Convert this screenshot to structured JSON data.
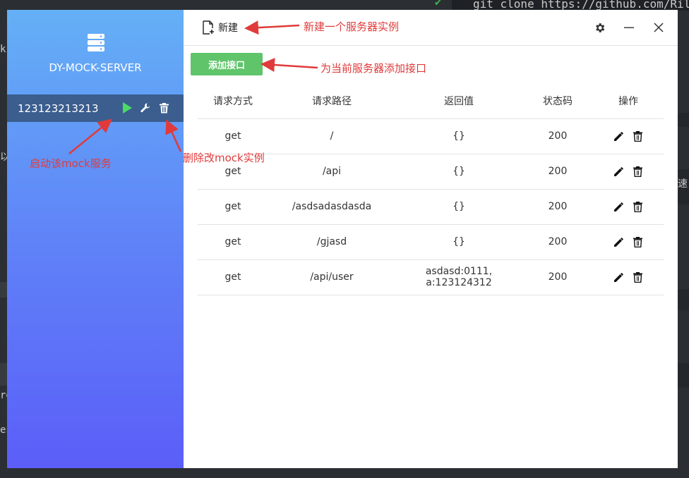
{
  "background": {
    "git_command": "git clone https://github.com/Rily",
    "left_fragments": [
      "k",
      "以",
      "ro",
      "es"
    ],
    "right_fragment": "速"
  },
  "sidebar": {
    "app_title": "DY-MOCK-SERVER",
    "server_icon": "server-icon",
    "instances": [
      {
        "name": "123123213213",
        "actions": [
          "play-icon",
          "wrench-icon",
          "trash-icon"
        ]
      }
    ]
  },
  "toolbar": {
    "new_label": "新建",
    "new_icon": "new-file-icon",
    "window_controls": [
      "gear-icon",
      "minimize-icon",
      "close-icon"
    ]
  },
  "main": {
    "add_api_label": "添加接口",
    "table": {
      "headers": [
        "请求方式",
        "请求路径",
        "返回值",
        "状态码",
        "操作"
      ],
      "rows": [
        {
          "method": "get",
          "path": "/",
          "response": "{}",
          "status": "200"
        },
        {
          "method": "get",
          "path": "/api",
          "response": "{}",
          "status": "200"
        },
        {
          "method": "get",
          "path": "/asdsadasdasda",
          "response": "{}",
          "status": "200"
        },
        {
          "method": "get",
          "path": "/gjasd",
          "response": "{}",
          "status": "200"
        },
        {
          "method": "get",
          "path": "/api/user",
          "response": "asdasd:0111, a:123124312",
          "status": "200"
        }
      ]
    }
  },
  "annotations": {
    "new_instance": "新建一个服务器实例",
    "add_api": "为当前服务器添加接口",
    "start_service": "启动该mock服务",
    "delete_instance": "删除改mock实例"
  },
  "colors": {
    "sidebar_top": "#64b0f6",
    "sidebar_bottom": "#5b5ef8",
    "selected_row": "#3b5e8f",
    "play_green": "#4cd964",
    "add_button": "#5fc46a",
    "annotation_red": "#e03a3a"
  }
}
